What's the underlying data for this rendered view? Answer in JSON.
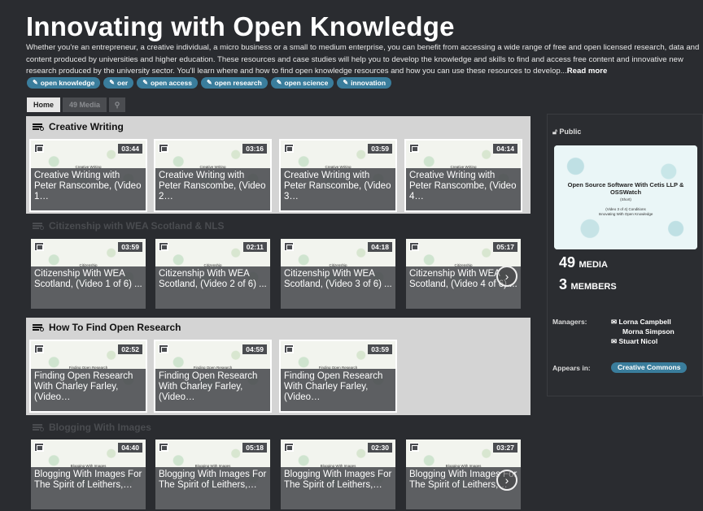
{
  "title": "Innovating with Open Knowledge",
  "description": "Whether you're an entrepreneur, a creative individual, a micro business or a small to medium enterprise, you can benefit from accessing a wide range of free and open licensed research, data and content produced by universities and higher education. These resources and case studies will help you to develop the knowledge and skills to find and access free content and innovative new research produced by the university sector. You'll learn where and how to find open knowledge resources and how you can use these resources to develop...",
  "read_more": "Read more",
  "tags": [
    "open knowledge",
    "oer",
    "open access",
    "open research",
    "open science",
    "innovation"
  ],
  "tabs": {
    "home": "Home",
    "media": "49 Media"
  },
  "sections": [
    {
      "title": "Creative Writing",
      "cards": [
        {
          "duration": "03:44",
          "small": "Creative Writing",
          "caption": "Creative Writing with Peter Ranscombe, (Video 1…"
        },
        {
          "duration": "03:16",
          "small": "Creative Writing",
          "caption": "Creative Writing with Peter Ranscombe, (Video 2…"
        },
        {
          "duration": "03:59",
          "small": "Creative Writing",
          "caption": "Creative Writing with Peter Ranscombe, (Video 3…"
        },
        {
          "duration": "04:14",
          "small": "Creative Writing",
          "caption": "Creative Writing with Peter Ranscombe, (Video 4…"
        }
      ]
    },
    {
      "title": "Citizenship with WEA Scotland & NLS",
      "cards": [
        {
          "duration": "03:59",
          "small": "Citizenship",
          "caption": "Citizenship With WEA Scotland, (Video 1 of 6) ..."
        },
        {
          "duration": "02:11",
          "small": "Citizenship",
          "caption": "Citizenship With WEA Scotland, (Video 2 of 6) ..."
        },
        {
          "duration": "04:18",
          "small": "Citizenship",
          "caption": "Citizenship With WEA Scotland, (Video 3 of 6) ..."
        },
        {
          "duration": "05:17",
          "small": "Citizenship",
          "caption": "Citizenship With WEA Scotland, (Video 4 of 6) ..."
        }
      ]
    },
    {
      "title": "How To Find Open Research",
      "cards": [
        {
          "duration": "02:52",
          "small": "Finding Open Research",
          "caption": "Finding Open Research With Charley Farley, (Video…"
        },
        {
          "duration": "04:59",
          "small": "Finding Open Research",
          "caption": "Finding Open Research With Charley Farley, (Video…"
        },
        {
          "duration": "03:59",
          "small": "Finding Open Research",
          "caption": "Finding Open Research With Charley Farley, (Video…"
        }
      ]
    },
    {
      "title": "Blogging With Images",
      "cards": [
        {
          "duration": "04:40",
          "small": "Blogging With Images",
          "caption": "Blogging With Images For The Spirit of Leithers,…"
        },
        {
          "duration": "05:18",
          "small": "Blogging With Images",
          "caption": "Blogging With Images For The Spirit of Leithers,…"
        },
        {
          "duration": "02:30",
          "small": "Blogging With Images",
          "caption": "Blogging With Images For The Spirit of Leithers,…"
        },
        {
          "duration": "03:27",
          "small": "Blogging With Images",
          "caption": "Blogging With Images For The Spirit of Leithers,…"
        }
      ]
    }
  ],
  "sidebar": {
    "visibility": "Public",
    "preview_title": "Open Source Software With Cetis LLP & OSSWatch",
    "preview_sub": "(Short)",
    "preview_sub2": "(Video 3 of 4) Conditions",
    "preview_sub3": "Innovating With Open Knowledge",
    "media_count": "49",
    "media_label": "MEDIA",
    "members_count": "3",
    "members_label": "MEMBERS",
    "managers_label": "Managers:",
    "managers": [
      "Lorna Campbell",
      "Morna Simpson",
      "Stuart Nicol"
    ],
    "appears_label": "Appears in:",
    "appears_in": "Creative Commons"
  },
  "colors": {
    "accent": "#3a7d9c",
    "background": "#2a2c30",
    "section_light": "#d4d4d4"
  }
}
